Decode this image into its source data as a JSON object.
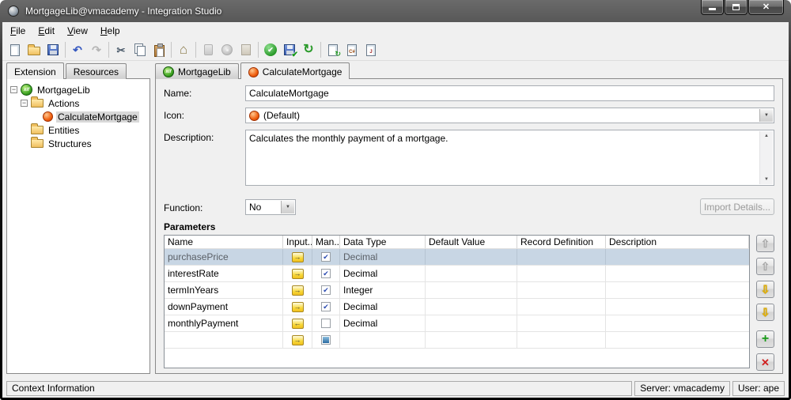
{
  "window": {
    "title": "MortgageLib@vmacademy - Integration Studio"
  },
  "menu": {
    "items": [
      "File",
      "Edit",
      "View",
      "Help"
    ]
  },
  "toolbar": {
    "buttons": [
      "new",
      "open",
      "save",
      "undo",
      "redo",
      "cut",
      "copy",
      "paste",
      "home",
      "connect-server",
      "database",
      "open-espace",
      "verify",
      "publish",
      "refresh",
      "update-source",
      "edit-csharp",
      "edit-java"
    ]
  },
  "icons": {
    "close": "✕",
    "undo": "↶",
    "redo": "↷",
    "cut": "✂",
    "home": "⌂",
    "check": "✔",
    "refresh": "↻",
    "dropdown": "▼",
    "scroll_up": "▲",
    "scroll_down": "▼",
    "up_arrow": "⇧",
    "down_arrow": "⇩",
    "add": "+",
    "delete": "✕",
    "collapse": "−",
    "xif_badge": "xif",
    "csharp_badge": "C#",
    "java_badge": "J"
  },
  "left_tabs": [
    "Extension",
    "Resources"
  ],
  "tree": {
    "items": [
      {
        "label": "MortgageLib",
        "icon": "xif",
        "expanded": true
      },
      {
        "label": "Actions",
        "icon": "folder",
        "expanded": true
      },
      {
        "label": "CalculateMortgage",
        "icon": "action",
        "selected": true
      },
      {
        "label": "Entities",
        "icon": "folder"
      },
      {
        "label": "Structures",
        "icon": "folder"
      }
    ]
  },
  "editor_tabs": [
    {
      "label": "MortgageLib",
      "icon": "xif"
    },
    {
      "label": "CalculateMortgage",
      "icon": "action",
      "active": true
    }
  ],
  "form": {
    "name_label": "Name:",
    "name_value": "CalculateMortgage",
    "icon_label": "Icon:",
    "icon_value": "(Default)",
    "description_label": "Description:",
    "description_value": "Calculates the monthly payment of a mortgage.",
    "function_label": "Function:",
    "function_value": "No",
    "import_button": "Import Details...",
    "parameters_title": "Parameters"
  },
  "parameters": {
    "headers": [
      "Name",
      "Input...",
      "Man...",
      "Data Type",
      "Default Value",
      "Record Definition",
      "Description"
    ],
    "rows": [
      {
        "name": "purchasePrice",
        "direction": "in",
        "mandatory": "checked",
        "data_type": "Decimal",
        "default_value": "",
        "record_definition": "",
        "description": "",
        "selected": true
      },
      {
        "name": "interestRate",
        "direction": "in",
        "mandatory": "checked",
        "data_type": "Decimal",
        "default_value": "",
        "record_definition": "",
        "description": ""
      },
      {
        "name": "termInYears",
        "direction": "in",
        "mandatory": "checked",
        "data_type": "Integer",
        "default_value": "",
        "record_definition": "",
        "description": ""
      },
      {
        "name": "downPayment",
        "direction": "in",
        "mandatory": "checked",
        "data_type": "Decimal",
        "default_value": "",
        "record_definition": "",
        "description": ""
      },
      {
        "name": "monthlyPayment",
        "direction": "out",
        "mandatory": "unchecked",
        "data_type": "Decimal",
        "default_value": "",
        "record_definition": "",
        "description": ""
      },
      {
        "name": "",
        "direction": "in",
        "mandatory": "indeterminate",
        "data_type": "",
        "default_value": "",
        "record_definition": "",
        "description": ""
      }
    ]
  },
  "status": {
    "context": "Context Information",
    "server": "Server: vmacademy",
    "user": "User: ape"
  }
}
